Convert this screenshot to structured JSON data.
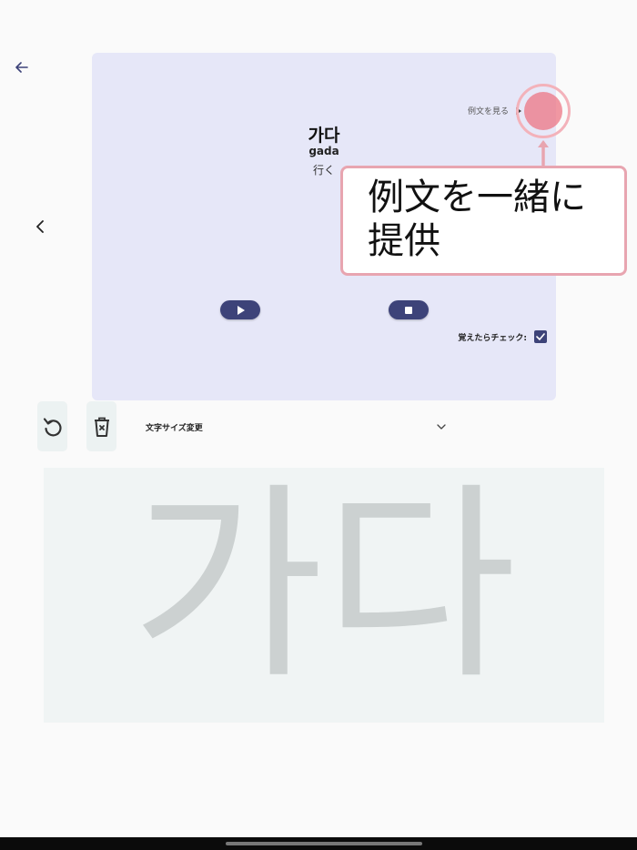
{
  "card": {
    "word": "가다",
    "romaji": "gada",
    "meaning": "行く",
    "example_link_label": "例文を見る",
    "check_label": "覚えたらチェック:",
    "checked": true
  },
  "callout": {
    "line1": "例文を一緒に",
    "line2": "提供"
  },
  "toolbar": {
    "font_size_label": "文字サイズ変更"
  },
  "writing_area": {
    "trace_text": "가다"
  },
  "icons": [
    "back-arrow-icon",
    "chevron-left-icon",
    "play-icon",
    "stop-icon",
    "check-icon",
    "reset-icon",
    "trash-icon",
    "chevron-down-icon",
    "arrow-right-icon"
  ],
  "colors": {
    "card_background": "#e6e7f8",
    "accent": "#3d4379",
    "highlight": "#ec7684",
    "callout_border": "#e8a5b0",
    "trace_text": "#ccd1d1"
  }
}
